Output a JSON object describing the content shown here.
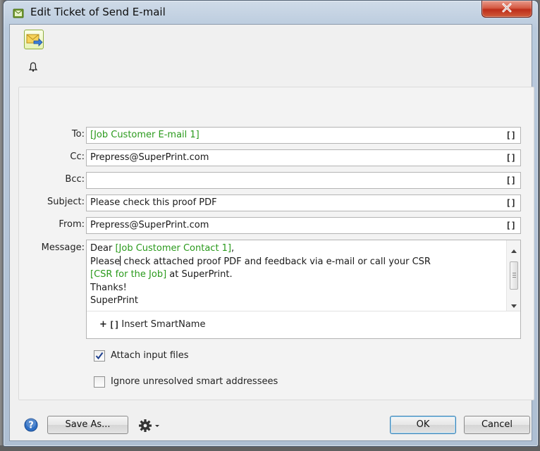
{
  "window": {
    "title": "Edit Ticket of Send E-mail"
  },
  "fields": {
    "to": {
      "label": "To:",
      "value": "[Job Customer E-mail 1]"
    },
    "cc": {
      "label": "Cc:",
      "value": "Prepress@SuperPrint.com"
    },
    "bcc": {
      "label": "Bcc:",
      "value": ""
    },
    "subject": {
      "label": "Subject:",
      "value": "Please check this proof PDF"
    },
    "from": {
      "label": "From:",
      "value": "Prepress@SuperPrint.com"
    },
    "smartname_button": "[]"
  },
  "message": {
    "label": "Message:",
    "line1_text": "Dear ",
    "line1_smart": "[Job Customer Contact 1]",
    "line1_end": ",",
    "line2_before_caret": "Please",
    "line2_after_caret": " check attached proof PDF and feedback via e-mail or call your CSR",
    "line3_smart": "[CSR for the Job]",
    "line3_text": " at SuperPrint.",
    "line4": "Thanks!",
    "line5": "SuperPrint"
  },
  "insert_smartname": {
    "plus": "+",
    "brackets": "[]",
    "label": "Insert SmartName"
  },
  "options": {
    "attach_input_files": {
      "label": "Attach input files",
      "checked": true
    },
    "ignore_unresolved": {
      "label": "Ignore unresolved smart addressees",
      "checked": false
    }
  },
  "footer": {
    "save_as_label": "Save As...",
    "ok_label": "OK",
    "cancel_label": "Cancel"
  },
  "icons": {
    "window_icon": "task-icon",
    "close": "close-icon",
    "task": "send-email-icon",
    "bell": "bell-icon",
    "help": "help-icon",
    "gear": "gear-icon"
  },
  "colors": {
    "smartname_green": "#2a9a1c",
    "close_red": "#c9402a",
    "ok_border_blue": "#3c7fb1"
  }
}
